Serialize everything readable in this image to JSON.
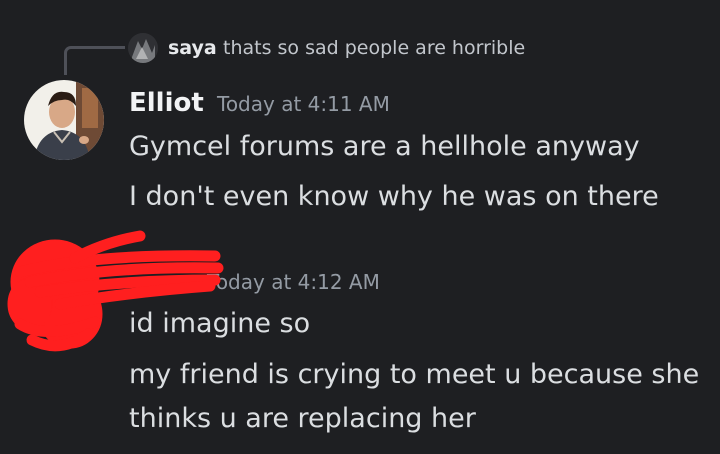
{
  "reply": {
    "author": "saya",
    "text": "thats so sad people are horrible"
  },
  "messages": [
    {
      "author": "Elliot",
      "timestamp": "Today at 4:11 AM",
      "lines": [
        "Gymcel forums are a hellhole anyway",
        "I don't even know why he was on there"
      ]
    },
    {
      "author": "",
      "timestamp": "Today at 4:12 AM",
      "lines": [
        "id imagine so",
        "my friend is crying to meet u because she",
        "thinks u are replacing her"
      ]
    }
  ],
  "colors": {
    "background": "#1e1f22",
    "text": "#dbdee1",
    "muted": "#949ba4",
    "redaction": "#ff1f1f"
  }
}
